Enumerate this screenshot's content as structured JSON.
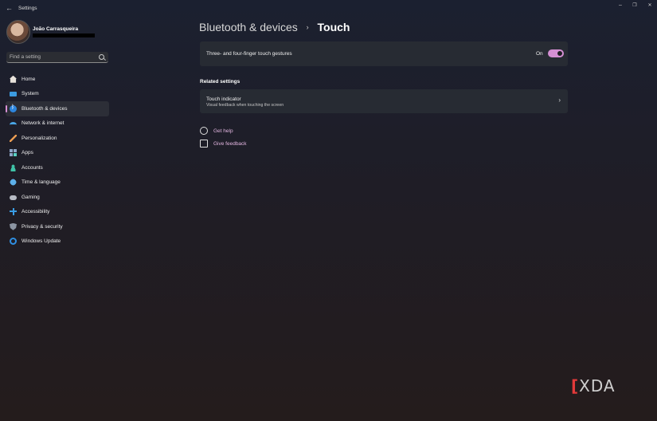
{
  "window": {
    "title": "Settings",
    "back_glyph": "←",
    "minimize_glyph": "–",
    "maximize_glyph": "❐",
    "close_glyph": "✕"
  },
  "profile": {
    "name": "João Carrasqueira"
  },
  "search": {
    "placeholder": "Find a setting"
  },
  "sidebar": {
    "items": [
      {
        "label": "Home",
        "icon": "home-icon"
      },
      {
        "label": "System",
        "icon": "monitor-icon"
      },
      {
        "label": "Bluetooth & devices",
        "icon": "bluetooth-icon",
        "active": true
      },
      {
        "label": "Network & internet",
        "icon": "wifi-icon"
      },
      {
        "label": "Personalization",
        "icon": "paintbrush-icon"
      },
      {
        "label": "Apps",
        "icon": "apps-icon"
      },
      {
        "label": "Accounts",
        "icon": "person-icon"
      },
      {
        "label": "Time & language",
        "icon": "globe-clock-icon"
      },
      {
        "label": "Gaming",
        "icon": "gamepad-icon"
      },
      {
        "label": "Accessibility",
        "icon": "accessibility-icon"
      },
      {
        "label": "Privacy & security",
        "icon": "shield-icon"
      },
      {
        "label": "Windows Update",
        "icon": "update-icon"
      }
    ]
  },
  "breadcrumb": {
    "parent": "Bluetooth & devices",
    "separator": "›",
    "current": "Touch"
  },
  "gestures": {
    "label": "Three- and four-finger touch gestures",
    "state_text": "On",
    "enabled": true
  },
  "related": {
    "heading": "Related settings",
    "touch_indicator": {
      "title": "Touch indicator",
      "description": "Visual feedback when touching the screen",
      "chevron": "›"
    }
  },
  "links": {
    "help": "Get help",
    "feedback": "Give feedback"
  },
  "watermark": {
    "text": "XDA",
    "bracket": "["
  },
  "colors": {
    "accent": "#d58fd4",
    "card": "#272b33",
    "link": "#e3b6e0"
  }
}
